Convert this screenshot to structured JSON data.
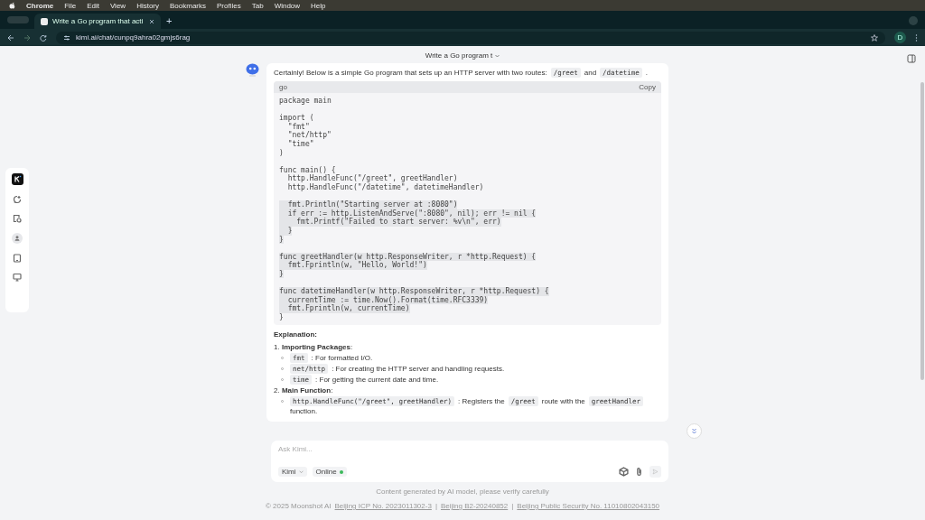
{
  "menu_bar": {
    "items": [
      "Chrome",
      "File",
      "Edit",
      "View",
      "History",
      "Bookmarks",
      "Profiles",
      "Tab",
      "Window",
      "Help"
    ]
  },
  "browser": {
    "tab_title": "Write a Go program that acti",
    "new_tab": "+",
    "url": "kimi.ai/chat/cunpq9ahra02gmjs6rag",
    "profile": "D"
  },
  "chat": {
    "title": "Write a Go program t",
    "intro": [
      {
        "text": "Certainly! Below is a simple Go program that sets up an HTTP server with two routes:"
      },
      {
        "code": "/greet"
      },
      {
        "text": "and"
      },
      {
        "code": "/datetime"
      },
      {
        "text": "."
      }
    ],
    "code_block": {
      "language": "go",
      "copy": "Copy",
      "groups": [
        [
          {
            "text": "package main",
            "selected": false
          }
        ],
        [
          {
            "text": "import (",
            "selected": false
          },
          {
            "text": "  \"fmt\"",
            "selected": false
          },
          {
            "text": "  \"net/http\"",
            "selected": false
          },
          {
            "text": "  \"time\"",
            "selected": false
          },
          {
            "text": ")",
            "selected": false
          }
        ],
        [
          {
            "text": "func main() {",
            "selected": false
          },
          {
            "text": "  http.HandleFunc(\"/greet\", greetHandler)",
            "selected": false
          },
          {
            "text": "  http.HandleFunc(\"/datetime\", datetimeHandler)",
            "selected": false
          }
        ],
        [
          {
            "text": "  fmt.Println(\"Starting server at :8080\")",
            "selected": true
          },
          {
            "text": "  if err := http.ListenAndServe(\":8080\", nil); err != nil {",
            "selected": true
          },
          {
            "text": "    fmt.Printf(\"Failed to start server: %v\\n\", err)",
            "selected": true
          },
          {
            "text": "  }",
            "selected": true
          },
          {
            "text": "}",
            "selected": true
          }
        ],
        [
          {
            "text": "func greetHandler(w http.ResponseWriter, r *http.Request) {",
            "selected": true
          },
          {
            "text": "  fmt.Fprintln(w, \"Hello, World!\")",
            "selected": true
          },
          {
            "text": "}",
            "selected": true
          }
        ],
        [
          {
            "text": "func datetimeHandler(w http.ResponseWriter, r *http.Request) {",
            "selected": true
          },
          {
            "text": "  currentTime := time.Now().Format(time.RFC3339)",
            "selected": true
          },
          {
            "text": "  fmt.Fprintln(w, currentTime)",
            "selected": true
          },
          {
            "text": "}",
            "selected": false
          }
        ]
      ]
    },
    "explanation_heading": "Explanation:",
    "sections": [
      {
        "number": "1.",
        "title": "Importing Packages",
        "colon": ":",
        "bullets": [
          [
            {
              "code": "fmt"
            },
            {
              "text": ": For formatted I/O."
            }
          ],
          [
            {
              "code": "net/http"
            },
            {
              "text": ": For creating the HTTP server and handling requests."
            }
          ],
          [
            {
              "code": "time"
            },
            {
              "text": ": For getting the current date and time."
            }
          ]
        ]
      },
      {
        "number": "2.",
        "title": "Main Function",
        "colon": ":",
        "bullets": [
          [
            {
              "code": "http.HandleFunc(\"/greet\", greetHandler)"
            },
            {
              "text": ": Registers the"
            },
            {
              "code": "/greet"
            },
            {
              "text": "route with the"
            },
            {
              "code": "greetHandler"
            },
            {
              "text": "function."
            }
          ]
        ]
      }
    ]
  },
  "input": {
    "placeholder": "Ask Kimi...",
    "model": "Kimi",
    "online": "Online",
    "online_on": true
  },
  "footer": {
    "notice": "Content generated by AI model, please verify carefully",
    "copyright": "© 2025 Moonshot AI",
    "links": [
      "Beijing ICP No. 2023011302-3",
      "Beijing B2-20240852",
      "Beijing Public Security No. 11010802043150"
    ],
    "separator": "|"
  }
}
